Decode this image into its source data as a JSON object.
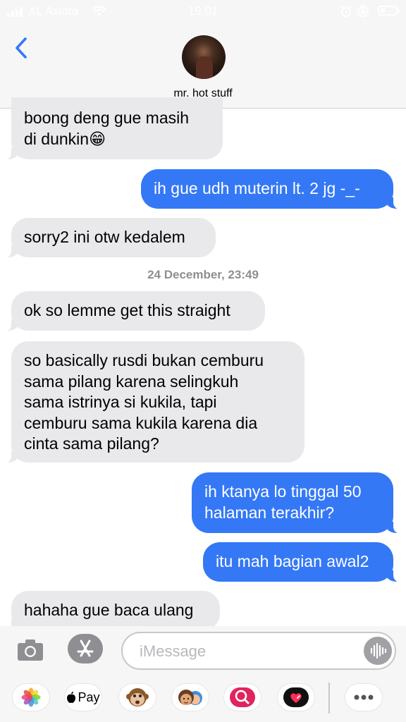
{
  "status_bar": {
    "carrier": "XL Axiata",
    "time": "19.01"
  },
  "header": {
    "contact_name": "mr. hot stuff",
    "back_icon": "chevron-left-icon"
  },
  "messages": [
    {
      "direction": "incoming",
      "text": "boong deng gue masih\ndi dunkin😁"
    },
    {
      "direction": "outgoing",
      "text": "ih gue udh muterin lt. 2 jg -_-"
    },
    {
      "direction": "incoming",
      "text": "sorry2 ini otw kedalem"
    },
    {
      "direction": "incoming",
      "text": "ok so lemme get this straight"
    },
    {
      "direction": "incoming",
      "text": "so basically rusdi bukan cemburu\nsama pilang karena selingkuh\nsama istrinya si kukila, tapi\ncemburu sama kukila karena dia\ncinta sama pilang?"
    },
    {
      "direction": "outgoing",
      "text": "ih ktanya lo tinggal 50\nhalaman terakhir?"
    },
    {
      "direction": "outgoing",
      "text": "itu mah bagian awal2"
    },
    {
      "direction": "incoming",
      "text": "hahaha gue baca ulang"
    }
  ],
  "timestamp": "24 December, 23:49",
  "input": {
    "placeholder": "iMessage"
  },
  "app_drawer": {
    "apple_pay_label": "Pay",
    "apps": [
      "photos-icon",
      "apple-pay-icon",
      "monkey-animoji-icon",
      "memoji-stickers-icon",
      "image-search-icon",
      "digital-touch-icon",
      "more-icon"
    ]
  },
  "colors": {
    "incoming_bubble": "#e9e9eb",
    "outgoing_bubble": "#3478f6",
    "timestamp": "#8e8e93",
    "accent": "#3478f6"
  }
}
